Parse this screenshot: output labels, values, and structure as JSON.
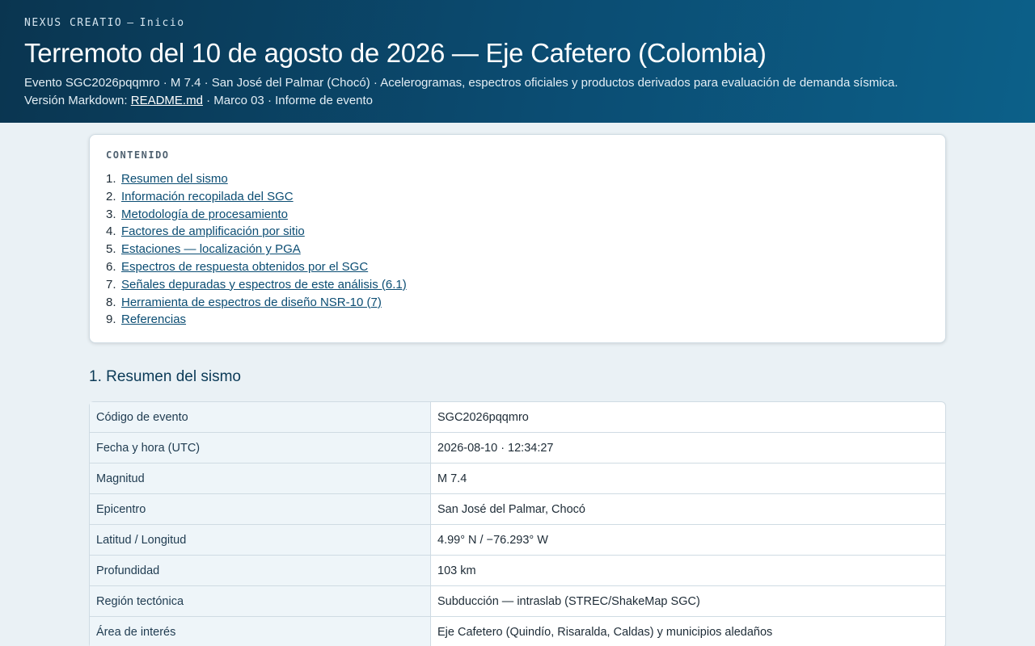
{
  "header": {
    "brand": "NEXUS CREATIO",
    "separator": "—",
    "home": "Inicio",
    "title": "Terremoto del 10 de agosto de 2026 — Eje Cafetero (Colombia)",
    "subtitle": "Evento SGC2026pqqmro · M 7.4 · San José del Palmar (Chocó) · Acelerogramas, espectros oficiales y productos derivados para evaluación de demanda sísmica.",
    "markdown_prefix": "Versión Markdown: ",
    "markdown_link": "README.md",
    "markdown_suffix": " · Marco 03 · Informe de evento"
  },
  "toc": {
    "title": "CONTENIDO",
    "items": [
      {
        "num": "1.",
        "label": "Resumen del sismo"
      },
      {
        "num": "2.",
        "label": "Información recopilada del SGC"
      },
      {
        "num": "3.",
        "label": "Metodología de procesamiento"
      },
      {
        "num": "4.",
        "label": "Factores de amplificación por sitio"
      },
      {
        "num": "5.",
        "label": "Estaciones — localización y PGA"
      },
      {
        "num": "6.",
        "label": "Espectros de respuesta obtenidos por el SGC"
      },
      {
        "num": "7.",
        "label": "Señales depuradas y espectros de este análisis (6.1)"
      },
      {
        "num": "8.",
        "label": "Herramienta de espectros de diseño NSR-10 (7)"
      },
      {
        "num": "9.",
        "label": "Referencias"
      }
    ]
  },
  "summary": {
    "heading": "1. Resumen del sismo",
    "rows": [
      {
        "key": "Código de evento",
        "value": "SGC2026pqqmro"
      },
      {
        "key": "Fecha y hora (UTC)",
        "value": "2026-08-10 · 12:34:27"
      },
      {
        "key": "Magnitud",
        "value": "M 7.4"
      },
      {
        "key": "Epicentro",
        "value": "San José del Palmar, Chocó"
      },
      {
        "key": "Latitud / Longitud",
        "value": "4.99° N / −76.293° W"
      },
      {
        "key": "Profundidad",
        "value": "103 km"
      },
      {
        "key": "Región tectónica",
        "value": "Subducción — intraslab (STREC/ShakeMap SGC)"
      },
      {
        "key": "Área de interés",
        "value": "Eje Cafetero (Quindío, Risaralda, Caldas) y municipios aledaños"
      }
    ]
  }
}
